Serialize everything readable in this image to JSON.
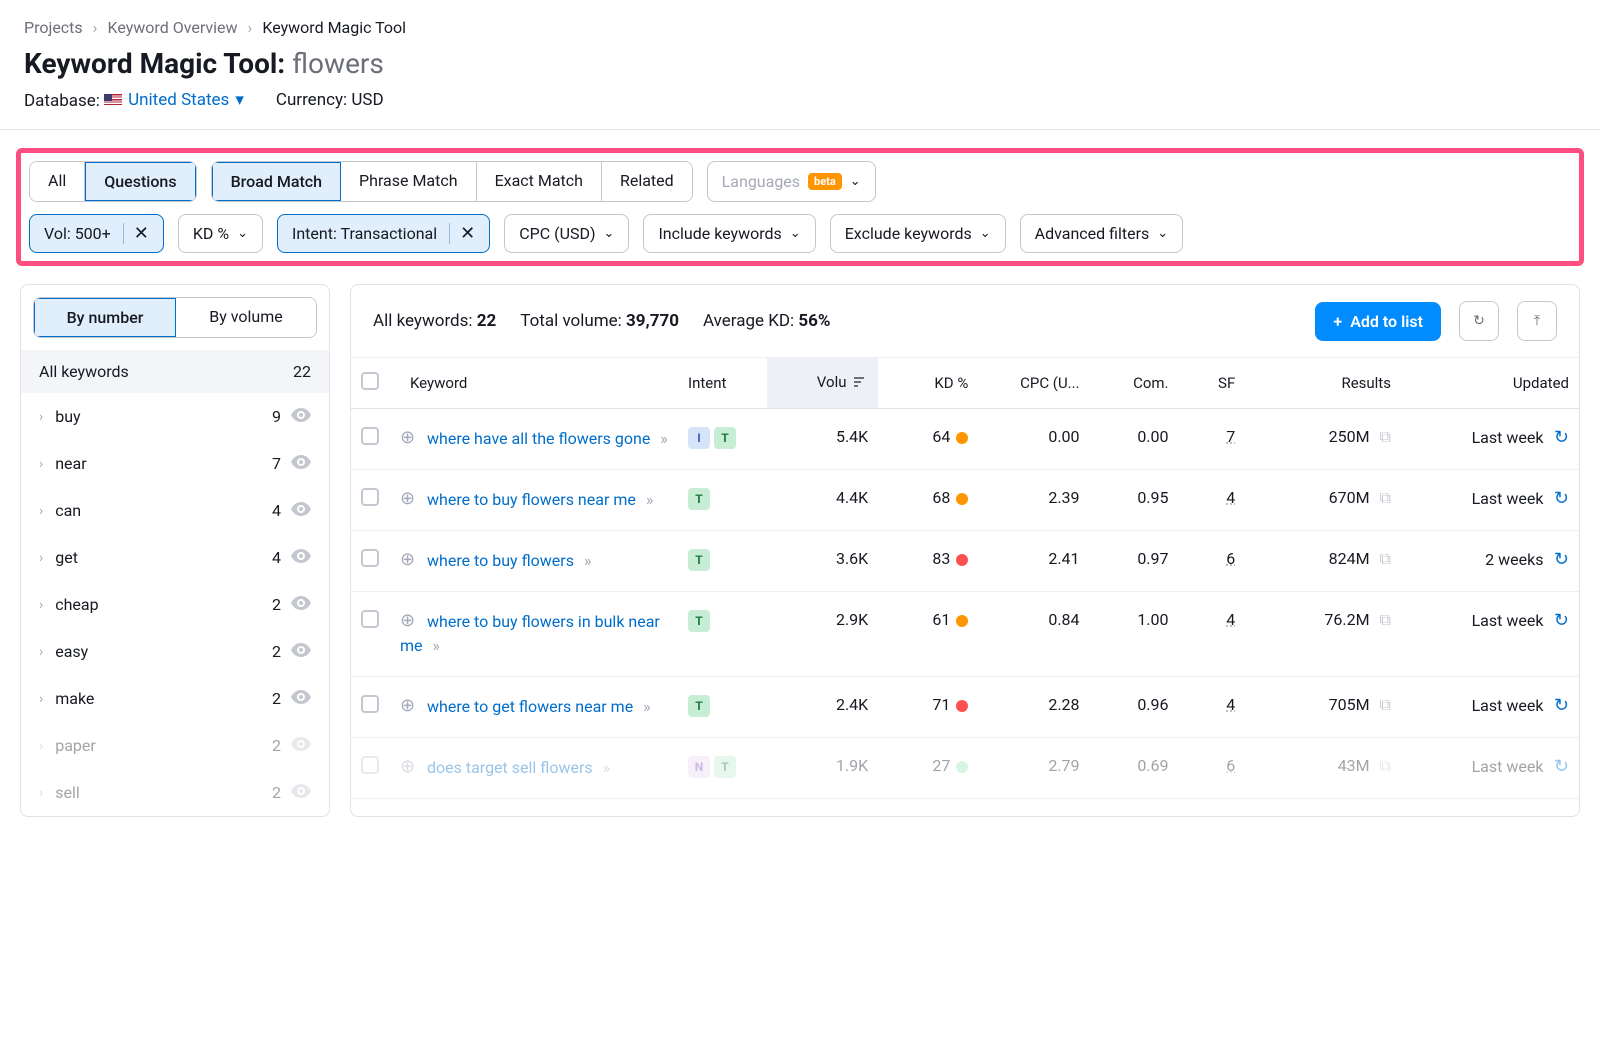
{
  "breadcrumb": {
    "projects": "Projects",
    "overview": "Keyword Overview",
    "current": "Keyword Magic Tool"
  },
  "title": {
    "label": "Keyword Magic Tool:",
    "keyword": "flowers"
  },
  "meta": {
    "database_label": "Database:",
    "country": "United States",
    "currency_label": "Currency:",
    "currency": "USD"
  },
  "segments": {
    "all": "All",
    "questions": "Questions",
    "broad": "Broad Match",
    "phrase": "Phrase Match",
    "exact": "Exact Match",
    "related": "Related"
  },
  "lang": {
    "label": "Languages",
    "beta": "beta"
  },
  "filters": {
    "vol": "Vol: 500+",
    "kd": "KD %",
    "intent": "Intent: Transactional",
    "cpc": "CPC (USD)",
    "include": "Include keywords",
    "exclude": "Exclude keywords",
    "advanced": "Advanced filters"
  },
  "sidebar": {
    "toggle": {
      "by_number": "By number",
      "by_volume": "By volume"
    },
    "all": {
      "label": "All keywords",
      "count": "22"
    },
    "items": [
      {
        "label": "buy",
        "count": "9"
      },
      {
        "label": "near",
        "count": "7"
      },
      {
        "label": "can",
        "count": "4"
      },
      {
        "label": "get",
        "count": "4"
      },
      {
        "label": "cheap",
        "count": "2"
      },
      {
        "label": "easy",
        "count": "2"
      },
      {
        "label": "make",
        "count": "2"
      },
      {
        "label": "paper",
        "count": "2"
      },
      {
        "label": "sell",
        "count": "2"
      }
    ]
  },
  "stats": {
    "all_label": "All keywords:",
    "all_val": "22",
    "vol_label": "Total volume:",
    "vol_val": "39,770",
    "kd_label": "Average KD:",
    "kd_val": "56%"
  },
  "actions": {
    "add": "Add to list"
  },
  "columns": {
    "keyword": "Keyword",
    "intent": "Intent",
    "volume": "Volu",
    "kd": "KD %",
    "cpc": "CPC (U...",
    "com": "Com.",
    "sf": "SF",
    "results": "Results",
    "updated": "Updated"
  },
  "rows": [
    {
      "keyword": "where have all the flowers gone",
      "intents": [
        "I",
        "T"
      ],
      "volume": "5.4K",
      "kd": "64",
      "kd_color": "orange",
      "cpc": "0.00",
      "com": "0.00",
      "sf": "7",
      "results": "250M",
      "updated": "Last week"
    },
    {
      "keyword": "where to buy flowers near me",
      "intents": [
        "T"
      ],
      "volume": "4.4K",
      "kd": "68",
      "kd_color": "orange",
      "cpc": "2.39",
      "com": "0.95",
      "sf": "4",
      "results": "670M",
      "updated": "Last week"
    },
    {
      "keyword": "where to buy flowers",
      "intents": [
        "T"
      ],
      "volume": "3.6K",
      "kd": "83",
      "kd_color": "red",
      "cpc": "2.41",
      "com": "0.97",
      "sf": "6",
      "results": "824M",
      "updated": "2 weeks"
    },
    {
      "keyword": "where to buy flowers in bulk near me",
      "intents": [
        "T"
      ],
      "volume": "2.9K",
      "kd": "61",
      "kd_color": "orange",
      "cpc": "0.84",
      "com": "1.00",
      "sf": "4",
      "results": "76.2M",
      "updated": "Last week"
    },
    {
      "keyword": "where to get flowers near me",
      "intents": [
        "T"
      ],
      "volume": "2.4K",
      "kd": "71",
      "kd_color": "red",
      "cpc": "2.28",
      "com": "0.96",
      "sf": "4",
      "results": "705M",
      "updated": "Last week"
    },
    {
      "keyword": "does target sell flowers",
      "intents": [
        "N",
        "T"
      ],
      "volume": "1.9K",
      "kd": "27",
      "kd_color": "green",
      "cpc": "2.79",
      "com": "0.69",
      "sf": "6",
      "results": "43M",
      "updated": "Last week",
      "faded": true
    }
  ]
}
